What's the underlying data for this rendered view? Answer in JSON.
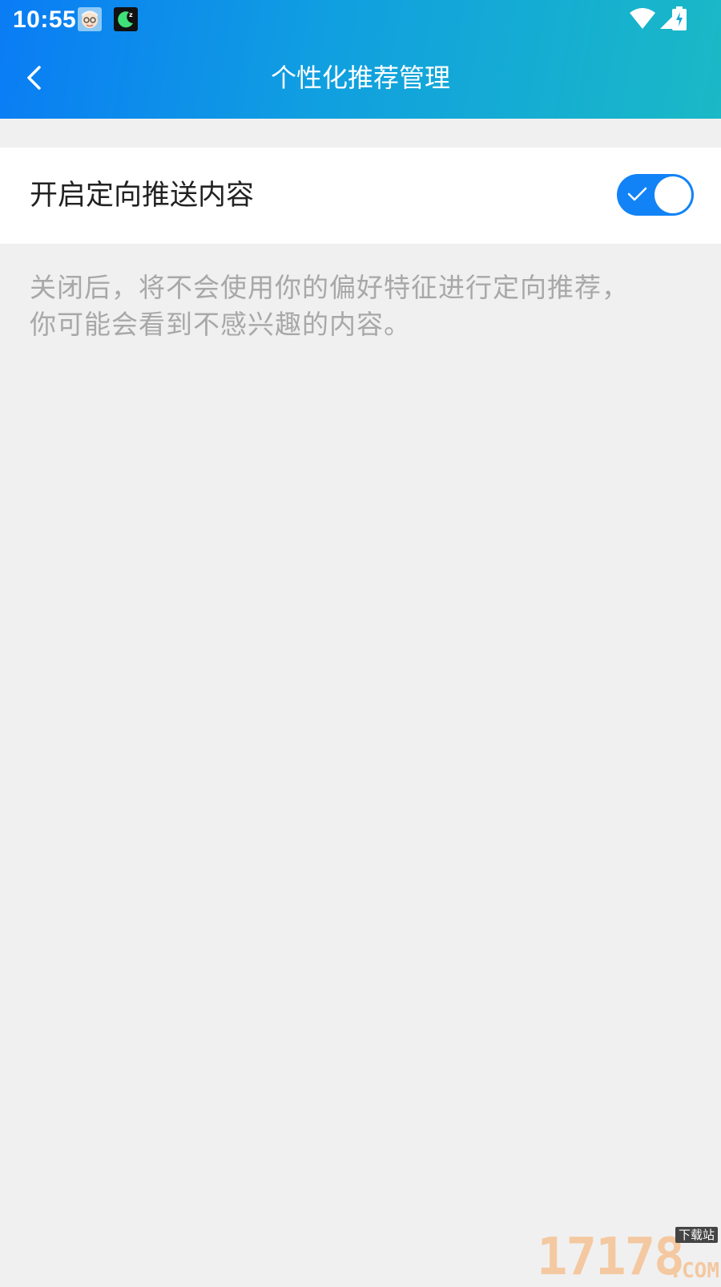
{
  "status_bar": {
    "time": "10:55",
    "notification_icons": [
      "avatar-app-icon",
      "sleep-app-icon"
    ],
    "system_icons": [
      "wifi-icon",
      "cell-signal-icon",
      "battery-charging-icon"
    ]
  },
  "nav": {
    "back_icon": "chevron-left-icon",
    "title": "个性化推荐管理"
  },
  "settings": {
    "targeted_push": {
      "label": "开启定向推送内容",
      "enabled": true
    },
    "description": "关闭后，将不会使用你的偏好特征进行定向推荐，你可能会看到不感兴趣的内容。"
  },
  "watermark": {
    "digits": "17178",
    "tag": "下载站",
    "suffix": ".COM"
  },
  "colors": {
    "header_start": "#0a7cf5",
    "header_end": "#1ab9c6",
    "toggle_on": "#1183f7",
    "page_background": "#f0f0f0",
    "description_text": "#a8a8a8"
  }
}
